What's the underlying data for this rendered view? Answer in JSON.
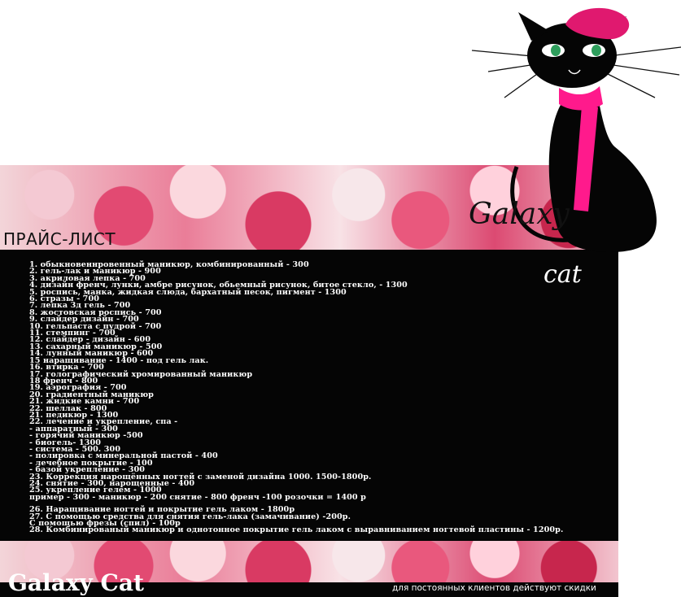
{
  "header": {
    "title": "ПРАЙС-ЛИСТ",
    "logo_top": "Galaxy",
    "logo_bottom": "cat"
  },
  "price_items": [
    "1. обыкновеннровенный маникюр, комбинированный - 300",
    "2. гель-лак и маникюр - 900",
    "3. акриловая лепка - 700",
    "4. дизайн френч, лунки, амбре рисунок, обьемный рисунок, битое стекло, - 1300",
    "5. роспись, манка, жидкая слюда, бархатный песок, пигмент - 1300",
    "6. стразы - 700",
    "7. лепка 3д гель - 700",
    "8. жостовская роспись - 700",
    "9. слайдер дизайн - 700",
    "10. гельпаста с пудрой - 700",
    "11. стемпинг - 700",
    "12. слайдер - дизайн - 600",
    "13. сахарный маникюр - 500",
    "14. лунный маникюр - 600",
    "15 наращивание - 1400 - под гель лак.",
    "16. втирка - 700",
    "17. голографический хромированный маникюр",
    "18 френч - 800",
    "19. аэрография - 700",
    "20. градиентный маникюр",
    "21. жидкие камни - 700",
    "22. шеллак - 800",
    "21. педикюр - 1300",
    "22. лечение и укрепление, спа -",
    "- аппаратный - 300",
    "- горячий маникюр -500",
    "- биогель- 1300",
    "- система - 500. 300",
    "- полировка с минеральной пастой - 400",
    "- лечебное покрытие - 100",
    "- базой укрепление - 300",
    "23. Коррекция нарощённых ногтей с заменой дизайна 1000. 1500-1800р.",
    "24. снятие - 300, нарощенные - 400",
    "25. укрепление гелем - 1000",
    "пример - 300 - маникюр - 200 снятие - 800 френч -100 розочки = 1400 р",
    "26. Наращивание ногтей и покрытие гель лаком - 1800р",
    "27. С помощью средства для снятия гель-лака (замачивание) -200р.",
    "С помощью фрезы (спил) - 100р",
    "28. Комбинированый маникюр и однотонное покрытие гель лаком с выравниванием ногтевой пластины - 1200р."
  ],
  "footer": {
    "brand": "Galaxy Cat",
    "discount_note": "для постоянных клиентов действуют скидки"
  },
  "colors": {
    "panel": "#050505",
    "beret": "#e0196f",
    "scarf": "#ff1a8c",
    "cat": "#050505"
  }
}
